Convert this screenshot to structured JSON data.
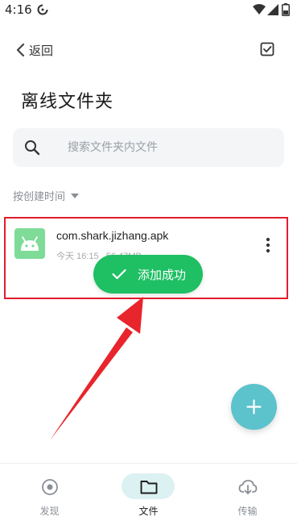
{
  "status_bar": {
    "time": "4:16",
    "icons": [
      "sync-icon",
      "wifi-icon",
      "signal-icon",
      "battery-icon"
    ]
  },
  "nav": {
    "back_label": "返回",
    "select_icon": "checkbox-icon"
  },
  "page_title": "离线文件夹",
  "search": {
    "placeholder": "搜索文件夹内文件",
    "value": ""
  },
  "sort": {
    "label": "按创建时间"
  },
  "files": [
    {
      "name": "com.shark.jizhang.apk",
      "date": "今天 16:15",
      "size": "56.47MB",
      "icon": "android-icon"
    }
  ],
  "toast": {
    "text": "添加成功"
  },
  "fab": {
    "icon": "plus-icon"
  },
  "bottom_nav": {
    "tabs": [
      {
        "label": "发现",
        "icon": "discover-icon",
        "active": false
      },
      {
        "label": "文件",
        "icon": "folder-icon",
        "active": true
      },
      {
        "label": "传输",
        "icon": "cloud-download-icon",
        "active": false
      }
    ]
  },
  "colors": {
    "highlight_border": "#e31c2d",
    "toast": "#1fbf64",
    "fab": "#5cc2cc",
    "active_tab_pill": "#dcf1f1",
    "apk_icon": "#7fdb98"
  }
}
